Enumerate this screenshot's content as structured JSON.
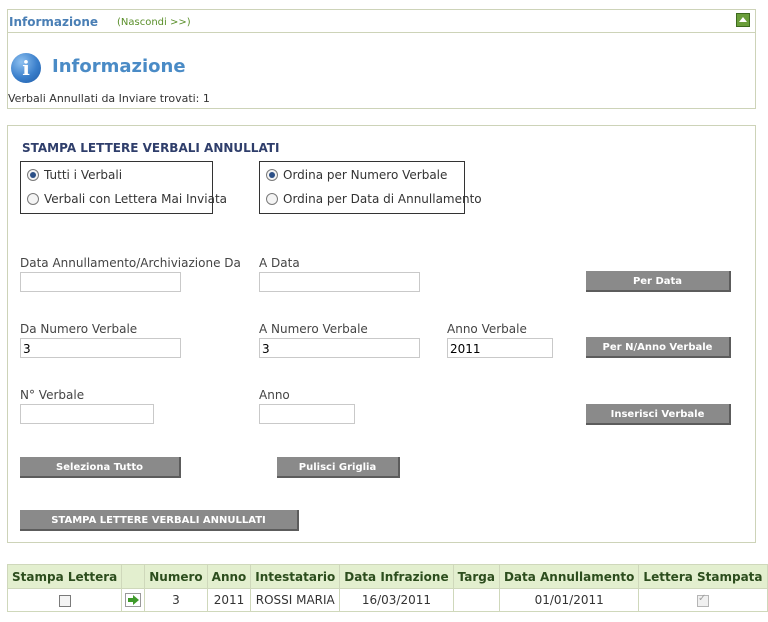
{
  "info_panel": {
    "header_title": "Informazione",
    "hide_link": "(Nascondi >>)",
    "title": "Informazione",
    "message": "Verbali Annullati da Inviare trovati: 1"
  },
  "form": {
    "title": "STAMPA LETTERE VERBALI ANNULLATI",
    "filter_options": [
      {
        "label": "Tutti i Verbali",
        "checked": true
      },
      {
        "label": "Verbali con Lettera Mai Inviata",
        "checked": false
      }
    ],
    "order_options": [
      {
        "label": "Ordina per Numero Verbale",
        "checked": true
      },
      {
        "label": "Ordina per Data di Annullamento",
        "checked": false
      }
    ],
    "date_from": {
      "label": "Data Annullamento/Archiviazione Da",
      "value": ""
    },
    "date_to": {
      "label": "A Data",
      "value": ""
    },
    "per_data_button": "Per Data",
    "num_from": {
      "label": "Da Numero Verbale",
      "value": "3"
    },
    "num_to": {
      "label": "A Numero Verbale",
      "value": "3"
    },
    "anno_verbale": {
      "label": "Anno Verbale",
      "value": "2011"
    },
    "per_num_anno_button": "Per N/Anno Verbale",
    "n_verbale": {
      "label": "N° Verbale",
      "value": ""
    },
    "anno": {
      "label": "Anno",
      "value": ""
    },
    "inserisci_button": "Inserisci Verbale",
    "seleziona_tutto_button": "Seleziona Tutto",
    "pulisci_button": "Pulisci Griglia",
    "stampa_button": "STAMPA LETTERE VERBALI ANNULLATI"
  },
  "grid": {
    "headers": [
      "Stampa Lettera",
      "",
      "Numero",
      "Anno",
      "Intestatario",
      "Data Infrazione",
      "Targa",
      "Data Annullamento",
      "Lettera Stampata"
    ],
    "rows": [
      {
        "stampa": false,
        "numero": "3",
        "anno": "2011",
        "intestatario": "ROSSI MARIA",
        "data_infrazione": "16/03/2011",
        "targa": "",
        "data_annullamento": "01/01/2011",
        "lettera_stampata": true
      }
    ]
  }
}
